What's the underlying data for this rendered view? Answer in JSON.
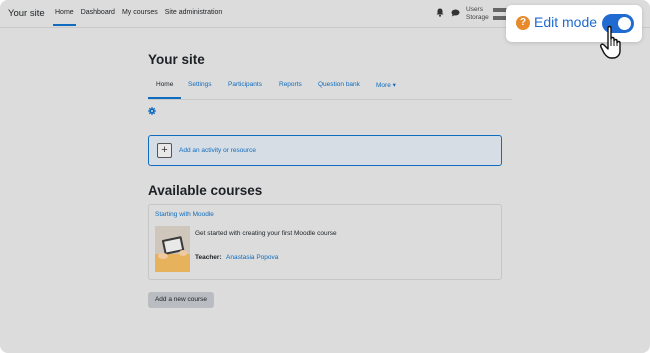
{
  "header": {
    "brand": "Your site",
    "nav": [
      "Home",
      "Dashboard",
      "My courses",
      "Site administration"
    ],
    "stats": {
      "users_label": "Users",
      "storage_label": "Storage"
    }
  },
  "callout": {
    "label": "Edit mode",
    "toggle_on": true,
    "help_icon": "?"
  },
  "page": {
    "title": "Your site",
    "tabs": [
      "Home",
      "Settings",
      "Participants",
      "Reports",
      "Question bank",
      "More ▾"
    ],
    "add_activity": "Add an activity or resource",
    "available_title": "Available courses",
    "course": {
      "name": "Starting with Moodle",
      "summary": "Get started with creating your first Moodle course",
      "teacher_label": "Teacher:",
      "teacher_name": "Anastasia Popova"
    },
    "add_course": "Add a new course"
  },
  "colors": {
    "accent": "#0f6cbf",
    "toggle": "#1f6bd1",
    "help": "#e8892b"
  }
}
